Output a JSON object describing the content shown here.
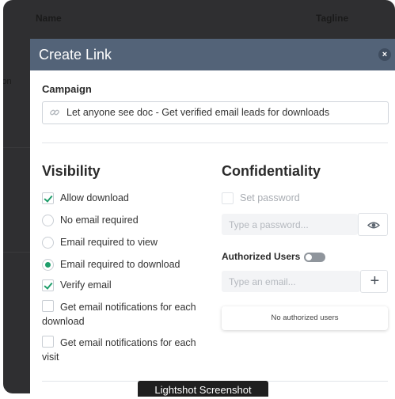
{
  "background": {
    "col_name": "Name",
    "col_tagline": "Tagline",
    "side_text": "ion"
  },
  "modal": {
    "title": "Create Link",
    "close_symbol": "×",
    "campaign": {
      "label": "Campaign",
      "value": "Let anyone see doc - Get verified email leads for downloads",
      "icon": "link-icon"
    },
    "visibility": {
      "title": "Visibility",
      "options": [
        {
          "label": "Allow download",
          "type": "checkbox",
          "checked": true
        },
        {
          "label": "No email required",
          "type": "radio",
          "checked": false
        },
        {
          "label": "Email required to view",
          "type": "radio",
          "checked": false
        },
        {
          "label": "Email required to download",
          "type": "radio",
          "checked": true
        },
        {
          "label": "Verify email",
          "type": "checkbox",
          "checked": true
        },
        {
          "label": "Get email notifications for each download",
          "type": "checkbox",
          "checked": false
        },
        {
          "label": "Get email notifications for each visit",
          "type": "checkbox",
          "checked": false
        }
      ]
    },
    "confidentiality": {
      "title": "Confidentiality",
      "set_password_label": "Set password",
      "set_password_checked": false,
      "password_placeholder": "Type a password...",
      "authorized_users_label": "Authorized Users",
      "authorized_users_enabled": false,
      "email_placeholder": "Type an email...",
      "add_symbol": "+",
      "no_users_text": "No authorized users"
    }
  },
  "tooltip": "Lightshot Screenshot",
  "colors": {
    "header": "#536378",
    "accent": "#1f9e6b",
    "overlay": "#2f2f31"
  }
}
